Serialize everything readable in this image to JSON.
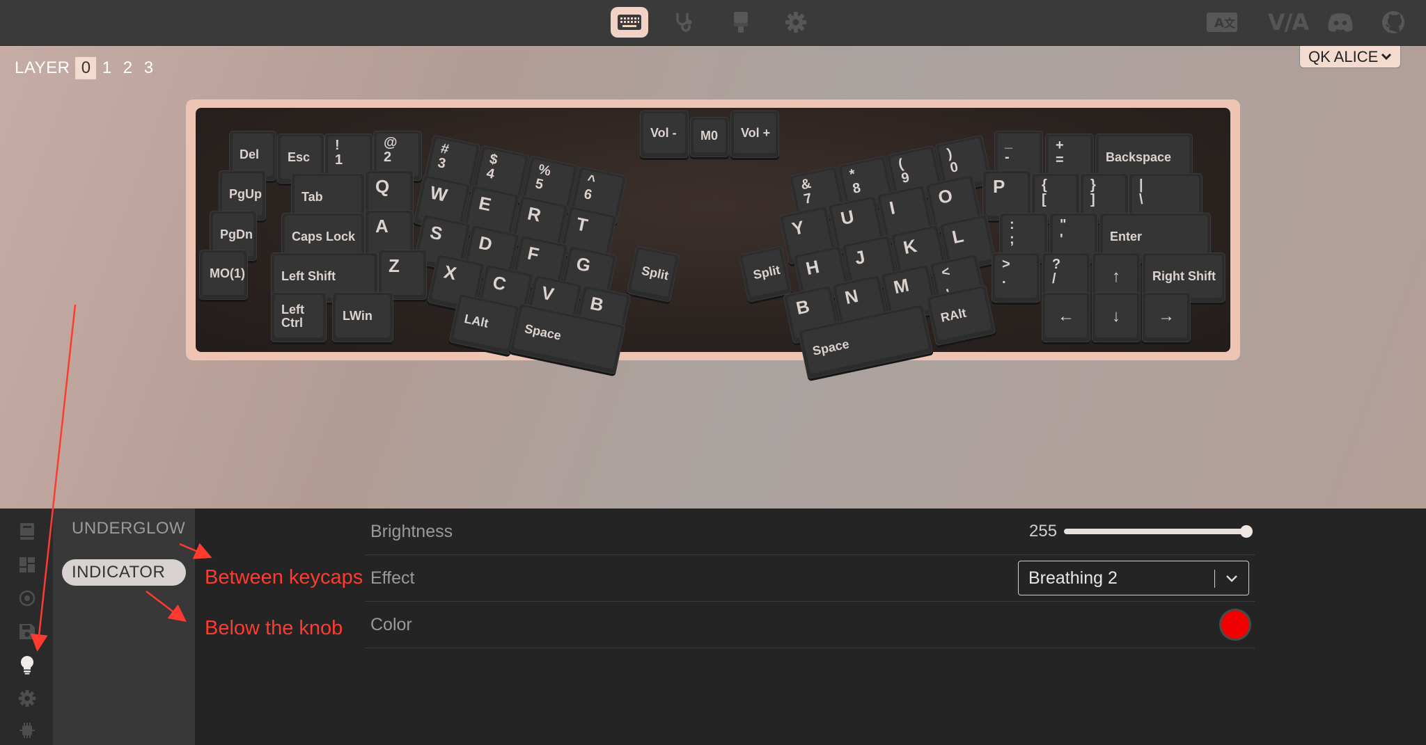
{
  "topbar": {
    "nav_icons": [
      "keyboard-icon",
      "stethoscope-icon",
      "paintbrush-icon",
      "gear-icon"
    ],
    "ext_icons": [
      "language-icon",
      "via-logo",
      "discord-icon",
      "github-icon"
    ],
    "via_text": "V/A",
    "active_color": "#f2d2c4"
  },
  "layers": {
    "label": "LAYER",
    "items": [
      "0",
      "1",
      "2",
      "3"
    ],
    "active": "0"
  },
  "keyboard_selector": {
    "value": "QK ALICE"
  },
  "keys": {
    "del": "Del",
    "pgup": "PgUp",
    "pgdn": "PgDn",
    "mo1": "MO(1)",
    "esc": "Esc",
    "n1": [
      "!",
      "1"
    ],
    "n2": [
      "@",
      "2"
    ],
    "n3": [
      "#",
      "3"
    ],
    "n4": [
      "$",
      "4"
    ],
    "n5": [
      "%",
      "5"
    ],
    "n6": [
      "^",
      "6"
    ],
    "tab": "Tab",
    "q": "Q",
    "w": "W",
    "e": "E",
    "r": "R",
    "t": "T",
    "caps": "Caps Lock",
    "a": "A",
    "s": "S",
    "d": "D",
    "f": "F",
    "g": "G",
    "lshift": "Left Shift",
    "z": "Z",
    "x": "X",
    "c": "C",
    "v": "V",
    "b_left": "B",
    "lctrl": "Left Ctrl",
    "lwin": "LWin",
    "lalt": "LAlt",
    "space_left": "Space",
    "split_left": "Split",
    "split_right": "Split",
    "voldown": "Vol -",
    "mo0": "M0",
    "volup": "Vol +",
    "n7": [
      "&",
      "7"
    ],
    "n8": [
      "*",
      "8"
    ],
    "n9": [
      "(",
      "9"
    ],
    "n0": [
      ")",
      "0"
    ],
    "minus": [
      "_",
      "-"
    ],
    "equal": [
      "+",
      "="
    ],
    "backspace": "Backspace",
    "y": "Y",
    "u": "U",
    "i": "I",
    "o": "O",
    "p": "P",
    "lbracket": [
      "{",
      "["
    ],
    "rbracket": [
      "}",
      "]"
    ],
    "backslash": [
      "|",
      "\\"
    ],
    "h": "H",
    "j": "J",
    "k": "K",
    "l": "L",
    "semicolon": [
      ":",
      ";"
    ],
    "quote": [
      "\"",
      "'"
    ],
    "enter": "Enter",
    "b_right": "B",
    "n": "N",
    "m": "M",
    "comma": [
      "<",
      ","
    ],
    "period": [
      ">",
      "."
    ],
    "slash": [
      "?",
      "/"
    ],
    "up": "↑",
    "rshift": "Right Shift",
    "space_right": "Space",
    "ralt": "RAlt",
    "left": "←",
    "down": "↓",
    "right": "→"
  },
  "sidebar": {
    "icons": [
      "book-icon",
      "dashboard-icon",
      "target-icon",
      "save-icon",
      "lightbulb-icon",
      "gear-icon",
      "chip-icon"
    ],
    "active": "lightbulb-icon"
  },
  "lighting_menu": {
    "items": [
      "UNDERGLOW",
      "INDICATOR"
    ],
    "active": "INDICATOR"
  },
  "settings": {
    "brightness": {
      "label": "Brightness",
      "value": "255",
      "max": 255
    },
    "effect": {
      "label": "Effect",
      "value": "Breathing 2"
    },
    "color": {
      "label": "Color",
      "value": "#f00000"
    }
  },
  "annotations": {
    "between": "Between keycaps",
    "below": "Below the knob",
    "color": "#ff3b30"
  }
}
